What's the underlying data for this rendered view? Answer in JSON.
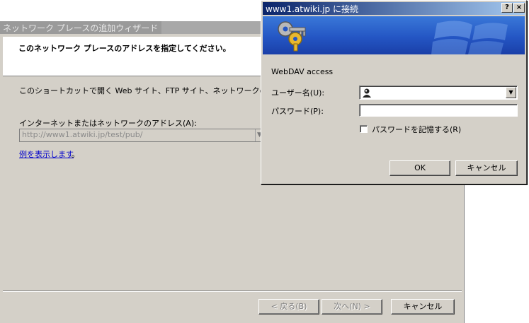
{
  "wizard": {
    "title": "ネットワーク プレースの追加ウィザード",
    "heading": "このネットワーク プレースのアドレスを指定してください。",
    "description": "このショートカットで開く Web サイト、FTP サイト、ネットワークの場所などの",
    "address_label": "インターネットまたはネットワークのアドレス(A):",
    "address_value": "http://www1.atwiki.jp/test/pub/",
    "example_link": "例を表示します",
    "example_tail": "。",
    "back_label": "< 戻る(B)",
    "next_label": "次へ(N) >",
    "cancel_label": "キャンセル"
  },
  "dialog": {
    "title": "www1.atwiki.jp に接続",
    "help_glyph": "?",
    "close_glyph": "×",
    "realm": "WebDAV access",
    "user_label": "ユーザー名(U):",
    "user_value": "",
    "password_label": "パスワード(P):",
    "remember_label": "パスワードを記憶する(R)",
    "remember_checked": false,
    "ok_label": "OK",
    "cancel_label": "キャンセル",
    "icons": [
      "keys-icon",
      "avatar-icon",
      "dropdown-arrow-icon"
    ]
  },
  "colors": {
    "titlebar_active": "#0a246a",
    "titlebar_gradient_end": "#a6caf0",
    "face": "#d4d0c8",
    "link": "#0000cc",
    "banner": "#2456c4"
  }
}
